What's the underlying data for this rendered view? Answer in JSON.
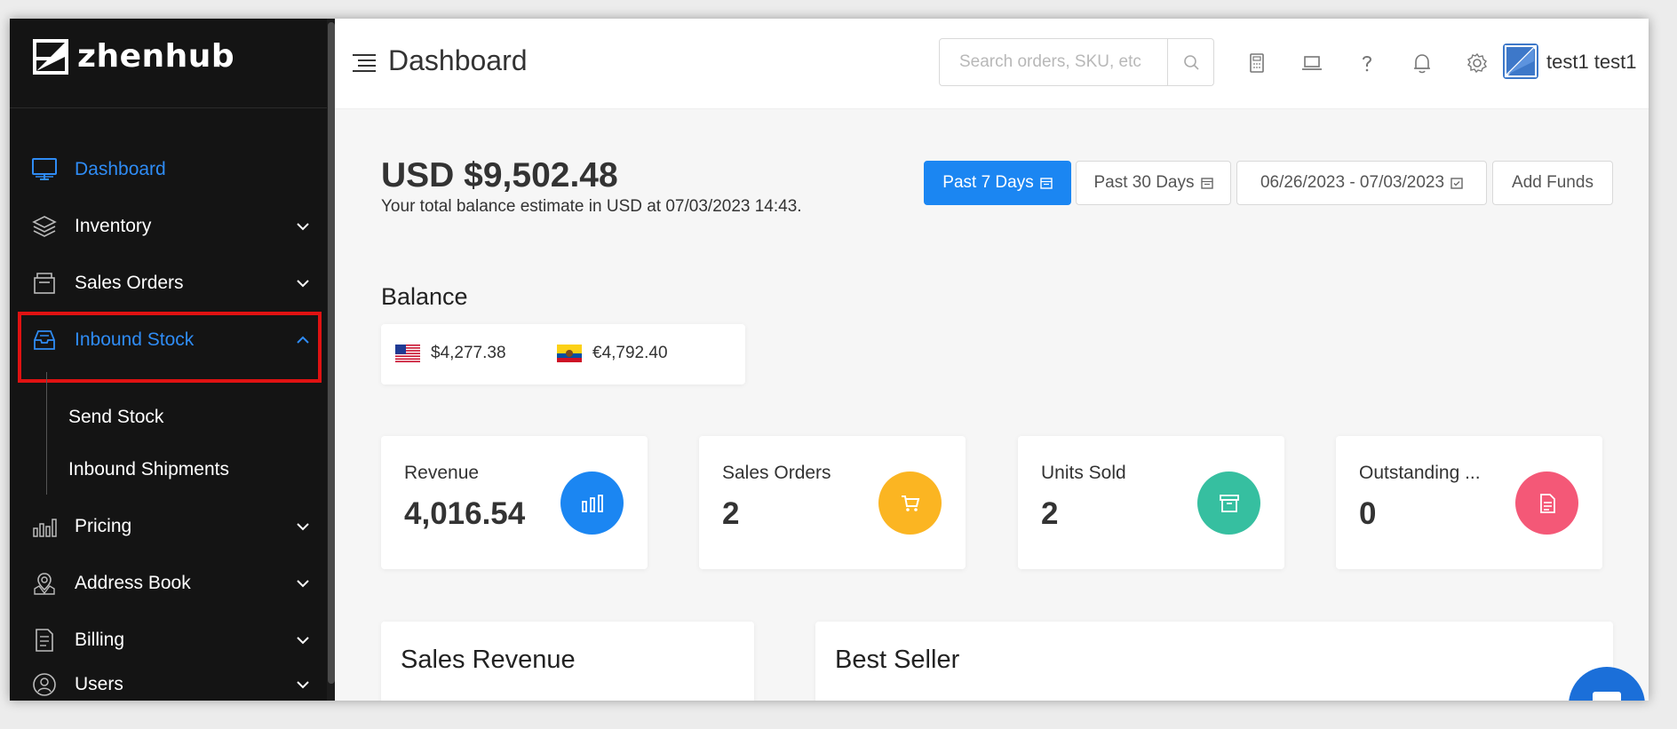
{
  "brand": {
    "name": "zhenhub"
  },
  "sidebar": {
    "items": [
      {
        "label": "Dashboard",
        "icon": "monitor-icon",
        "active": true,
        "expandable": false
      },
      {
        "label": "Inventory",
        "icon": "layers-icon",
        "expandable": true
      },
      {
        "label": "Sales Orders",
        "icon": "orders-icon",
        "expandable": true
      },
      {
        "label": "Inbound Stock",
        "icon": "inbox-icon",
        "active": true,
        "expanded": true
      },
      {
        "label": "Pricing",
        "icon": "bar-chart-icon",
        "expandable": true
      },
      {
        "label": "Address Book",
        "icon": "map-pin-icon",
        "expandable": true
      },
      {
        "label": "Billing",
        "icon": "document-icon",
        "expandable": true
      },
      {
        "label": "Users",
        "icon": "users-icon",
        "expandable": true
      }
    ],
    "inbound_sub": [
      "Send Stock",
      "Inbound Shipments"
    ]
  },
  "header": {
    "title": "Dashboard",
    "search_placeholder": "Search orders, SKU, etc",
    "icons": [
      "calculator-icon",
      "laptop-icon",
      "help-icon",
      "bell-icon",
      "settings-icon"
    ],
    "user_name": "test1 test1"
  },
  "balance": {
    "amount": "USD $9,502.48",
    "description": "Your total balance estimate in USD at 07/03/2023 14:43."
  },
  "filters": {
    "past7": "Past 7 Days",
    "past30": "Past 30 Days",
    "date_range": "06/26/2023 - 07/03/2023",
    "add_funds": "Add Funds"
  },
  "balance_section": {
    "title": "Balance",
    "currencies": [
      {
        "flag": "us-flag",
        "value": "$4,277.38"
      },
      {
        "flag": "eu-flag",
        "value": "€4,792.40"
      }
    ]
  },
  "stats": [
    {
      "label": "Revenue",
      "value": "4,016.54",
      "color": "#1b86f2",
      "icon": "bar-chart-icon"
    },
    {
      "label": "Sales Orders",
      "value": "2",
      "color": "#fbb522",
      "icon": "cart-icon"
    },
    {
      "label": "Units Sold",
      "value": "2",
      "color": "#36bfa0",
      "icon": "archive-icon"
    },
    {
      "label": "Outstanding ...",
      "value": "0",
      "color": "#f45877",
      "icon": "file-icon"
    }
  ],
  "panels": {
    "sales_revenue": "Sales Revenue",
    "best_seller": "Best Seller"
  },
  "colors": {
    "accent": "#1b86f2",
    "sidebar_bg": "#141414",
    "highlight": "#e01212"
  }
}
